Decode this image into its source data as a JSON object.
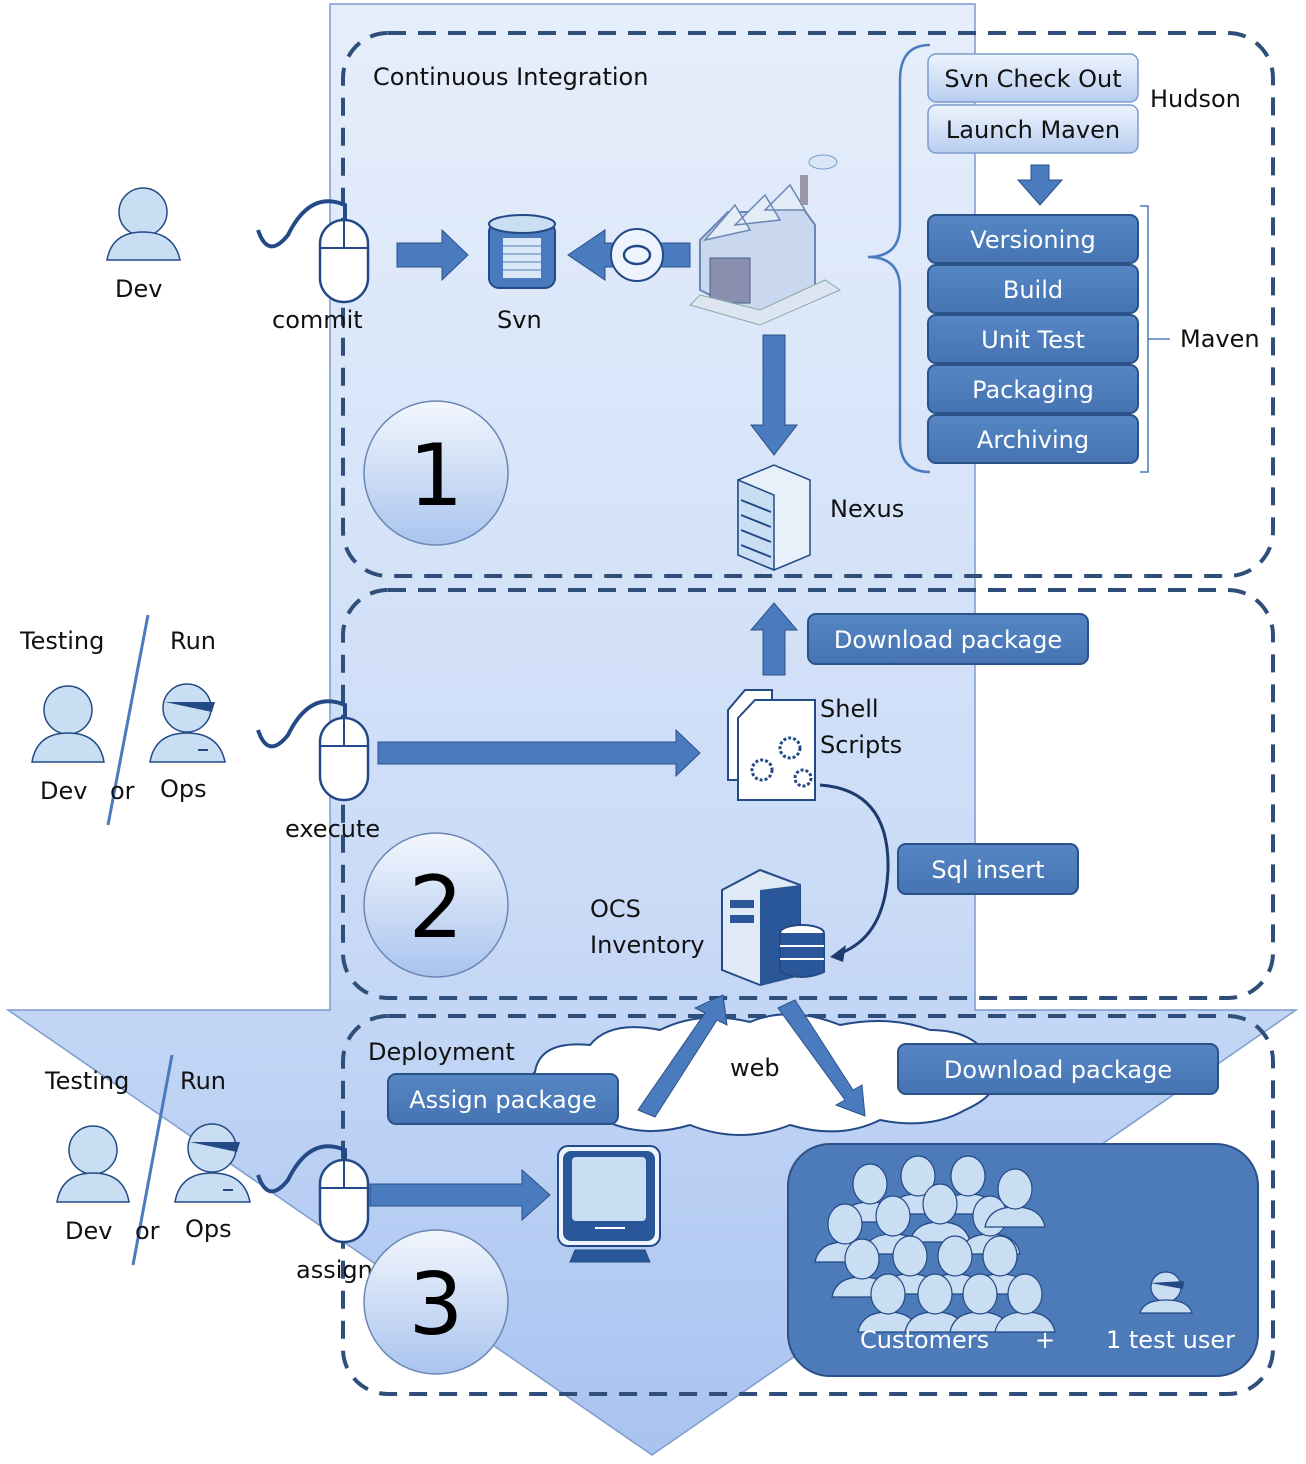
{
  "colors": {
    "band_fill_top": "#e3ecfb",
    "band_fill_bottom": "#b9cff5",
    "dashed_stroke": "#2f4f7a",
    "box_fill": "#4f7fbd",
    "box_stroke": "#2b5189",
    "arrow_fill": "#4a7bbf",
    "icon_light": "#c9def2",
    "icon_stroke": "#234a86"
  },
  "stage1": {
    "title": "Continuous Integration",
    "number": "1",
    "actor": "Dev",
    "action": "commit",
    "repo": "Svn",
    "artifact_repo": "Nexus",
    "hudson_label": "Hudson",
    "hudson_steps": [
      "Svn Check Out",
      "Launch Maven"
    ],
    "maven_label": "Maven",
    "maven_steps": [
      "Versioning",
      "Build",
      "Unit Test",
      "Packaging",
      "Archiving"
    ]
  },
  "stage2": {
    "number": "2",
    "role_left": "Testing",
    "role_right": "Run",
    "actor_left": "Dev",
    "actor_or": "or",
    "actor_right": "Ops",
    "action": "execute",
    "scripts_line1": "Shell",
    "scripts_line2": "Scripts",
    "download_label": "Download package",
    "sql_label": "Sql insert",
    "inventory_line1": "OCS",
    "inventory_line2": "Inventory"
  },
  "stage3": {
    "number": "3",
    "title": "Deployment",
    "role_left": "Testing",
    "role_right": "Run",
    "actor_left": "Dev",
    "actor_or": "or",
    "actor_right": "Ops",
    "action": "assign",
    "assign_label": "Assign package",
    "web_label": "web",
    "download_label": "Download package",
    "customers_label": "Customers",
    "plus_label": "+",
    "test_user_label": "1 test user"
  }
}
